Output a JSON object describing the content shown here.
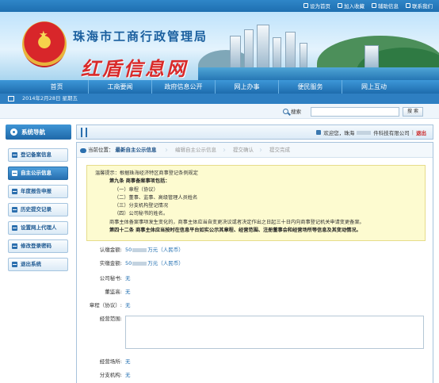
{
  "topbar": {
    "links": [
      {
        "label": "设为首页",
        "icon": "home-icon"
      },
      {
        "label": "加入收藏",
        "icon": "star-icon"
      },
      {
        "label": "辅助信息",
        "icon": "info-icon"
      },
      {
        "label": "联系我们",
        "icon": "mail-icon"
      }
    ]
  },
  "banner": {
    "bureau_title": "珠海市工商行政管理局",
    "brand": "红盾信息网"
  },
  "nav": {
    "items": [
      "首页",
      "工商要闻",
      "政府信息公开",
      "网上办事",
      "便民服务",
      "网上互动"
    ]
  },
  "datebar": {
    "date": "2014年2月28日 星期五"
  },
  "search": {
    "label": "搜索",
    "value": "",
    "button": "搜 索"
  },
  "sidebar": {
    "title": "系统导航",
    "items": [
      "登记备案信息",
      "自主公示信息",
      "年度报告申报",
      "历史提交记录",
      "设置网上代理人",
      "修改登录密码",
      "退出系统"
    ],
    "active_index": 1
  },
  "header": {
    "welcome": "欢迎您，珠海",
    "company_suffix": "件科技有限公司",
    "separator": "|",
    "logout": "退出"
  },
  "breadcrumb": {
    "prefix": "当前位置：",
    "steps": [
      "最新自主公示信息",
      "编辑自主公示信息",
      "提交确认",
      "提交完成"
    ],
    "current_index": 0
  },
  "notice": {
    "lines": [
      "温馨提示：根据珠海经济特区商事登记条例规定",
      "第九条 商事备案事项包括：",
      "（一）章程（协议）",
      "（二）董事、监事、高级管理人员姓名",
      "（三）分支机构登记情况",
      "（四）公司秘书的姓名。",
      "商事主体备案事项发生变化的，商事主体应当自变更决议或者决定作出之日起三十日内向商事登记机关申请变更备案。",
      "第四十二条 商事主体应当按时在信息平台如实公示其章程、经营范围、注册董事会和经营场所等信息及其变动情况。"
    ]
  },
  "form": {
    "fields": [
      {
        "label": "认缴金额:",
        "value_prefix": "50",
        "value_suffix": "万元（人民币）"
      },
      {
        "label": "实缴金额:",
        "value_prefix": "50",
        "value_suffix": "万元（人民币）"
      },
      {
        "label": "公司秘书:",
        "value": "无"
      },
      {
        "label": "董监高:",
        "value": "无"
      },
      {
        "label": "章程（协议）:",
        "value": "无"
      },
      {
        "label": "经营范围:",
        "value": ""
      },
      {
        "label": "经营场所:",
        "value": "无"
      },
      {
        "label": "分支机构:",
        "value": "无"
      }
    ]
  },
  "colors": {
    "nav_blue": "#1e6cad",
    "brand_red": "#d92a2a",
    "link_blue": "#1f6db0",
    "notice_bg": "#fdfbd0"
  }
}
